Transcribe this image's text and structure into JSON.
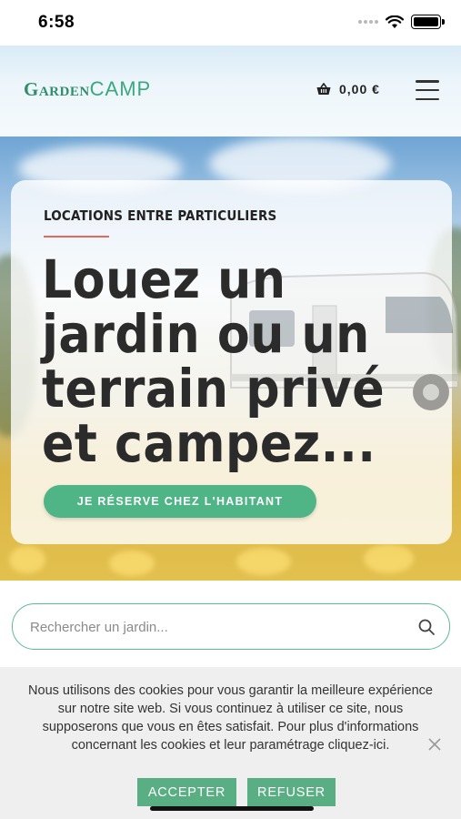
{
  "status_bar": {
    "time": "6:58"
  },
  "header": {
    "logo_part1": "Garden",
    "logo_part2": "CAMP",
    "cart_total": "0,00 €"
  },
  "hero": {
    "kicker": "LOCATIONS ENTRE PARTICULIERS",
    "title_lines": [
      "Louez un",
      "jardin ou un",
      "terrain privé",
      "et campez..."
    ],
    "cta_label": "JE RÉSERVE CHEZ L'HABITANT"
  },
  "search": {
    "placeholder": "Rechercher un jardin..."
  },
  "cookie": {
    "text": "Nous utilisons des cookies pour vous garantir la meilleure expérience sur notre site web. Si vous continuez à utiliser ce site, nous supposerons que vous en êtes satisfait. Pour plus d'informations concernant les cookies et leur paramétrage",
    "link_text": "cliquez-ici",
    "link_suffix": ".",
    "accept_label": "ACCEPTER",
    "refuse_label": "REFUSER"
  },
  "colors": {
    "brand_green": "#4fb486",
    "logo_green": "#2f8f6a",
    "accent_red": "#e06b5d",
    "cookie_button": "#5aae84"
  },
  "icons": [
    "wifi-icon",
    "battery-icon",
    "basket-icon",
    "hamburger-menu-icon",
    "search-icon",
    "close-icon"
  ]
}
